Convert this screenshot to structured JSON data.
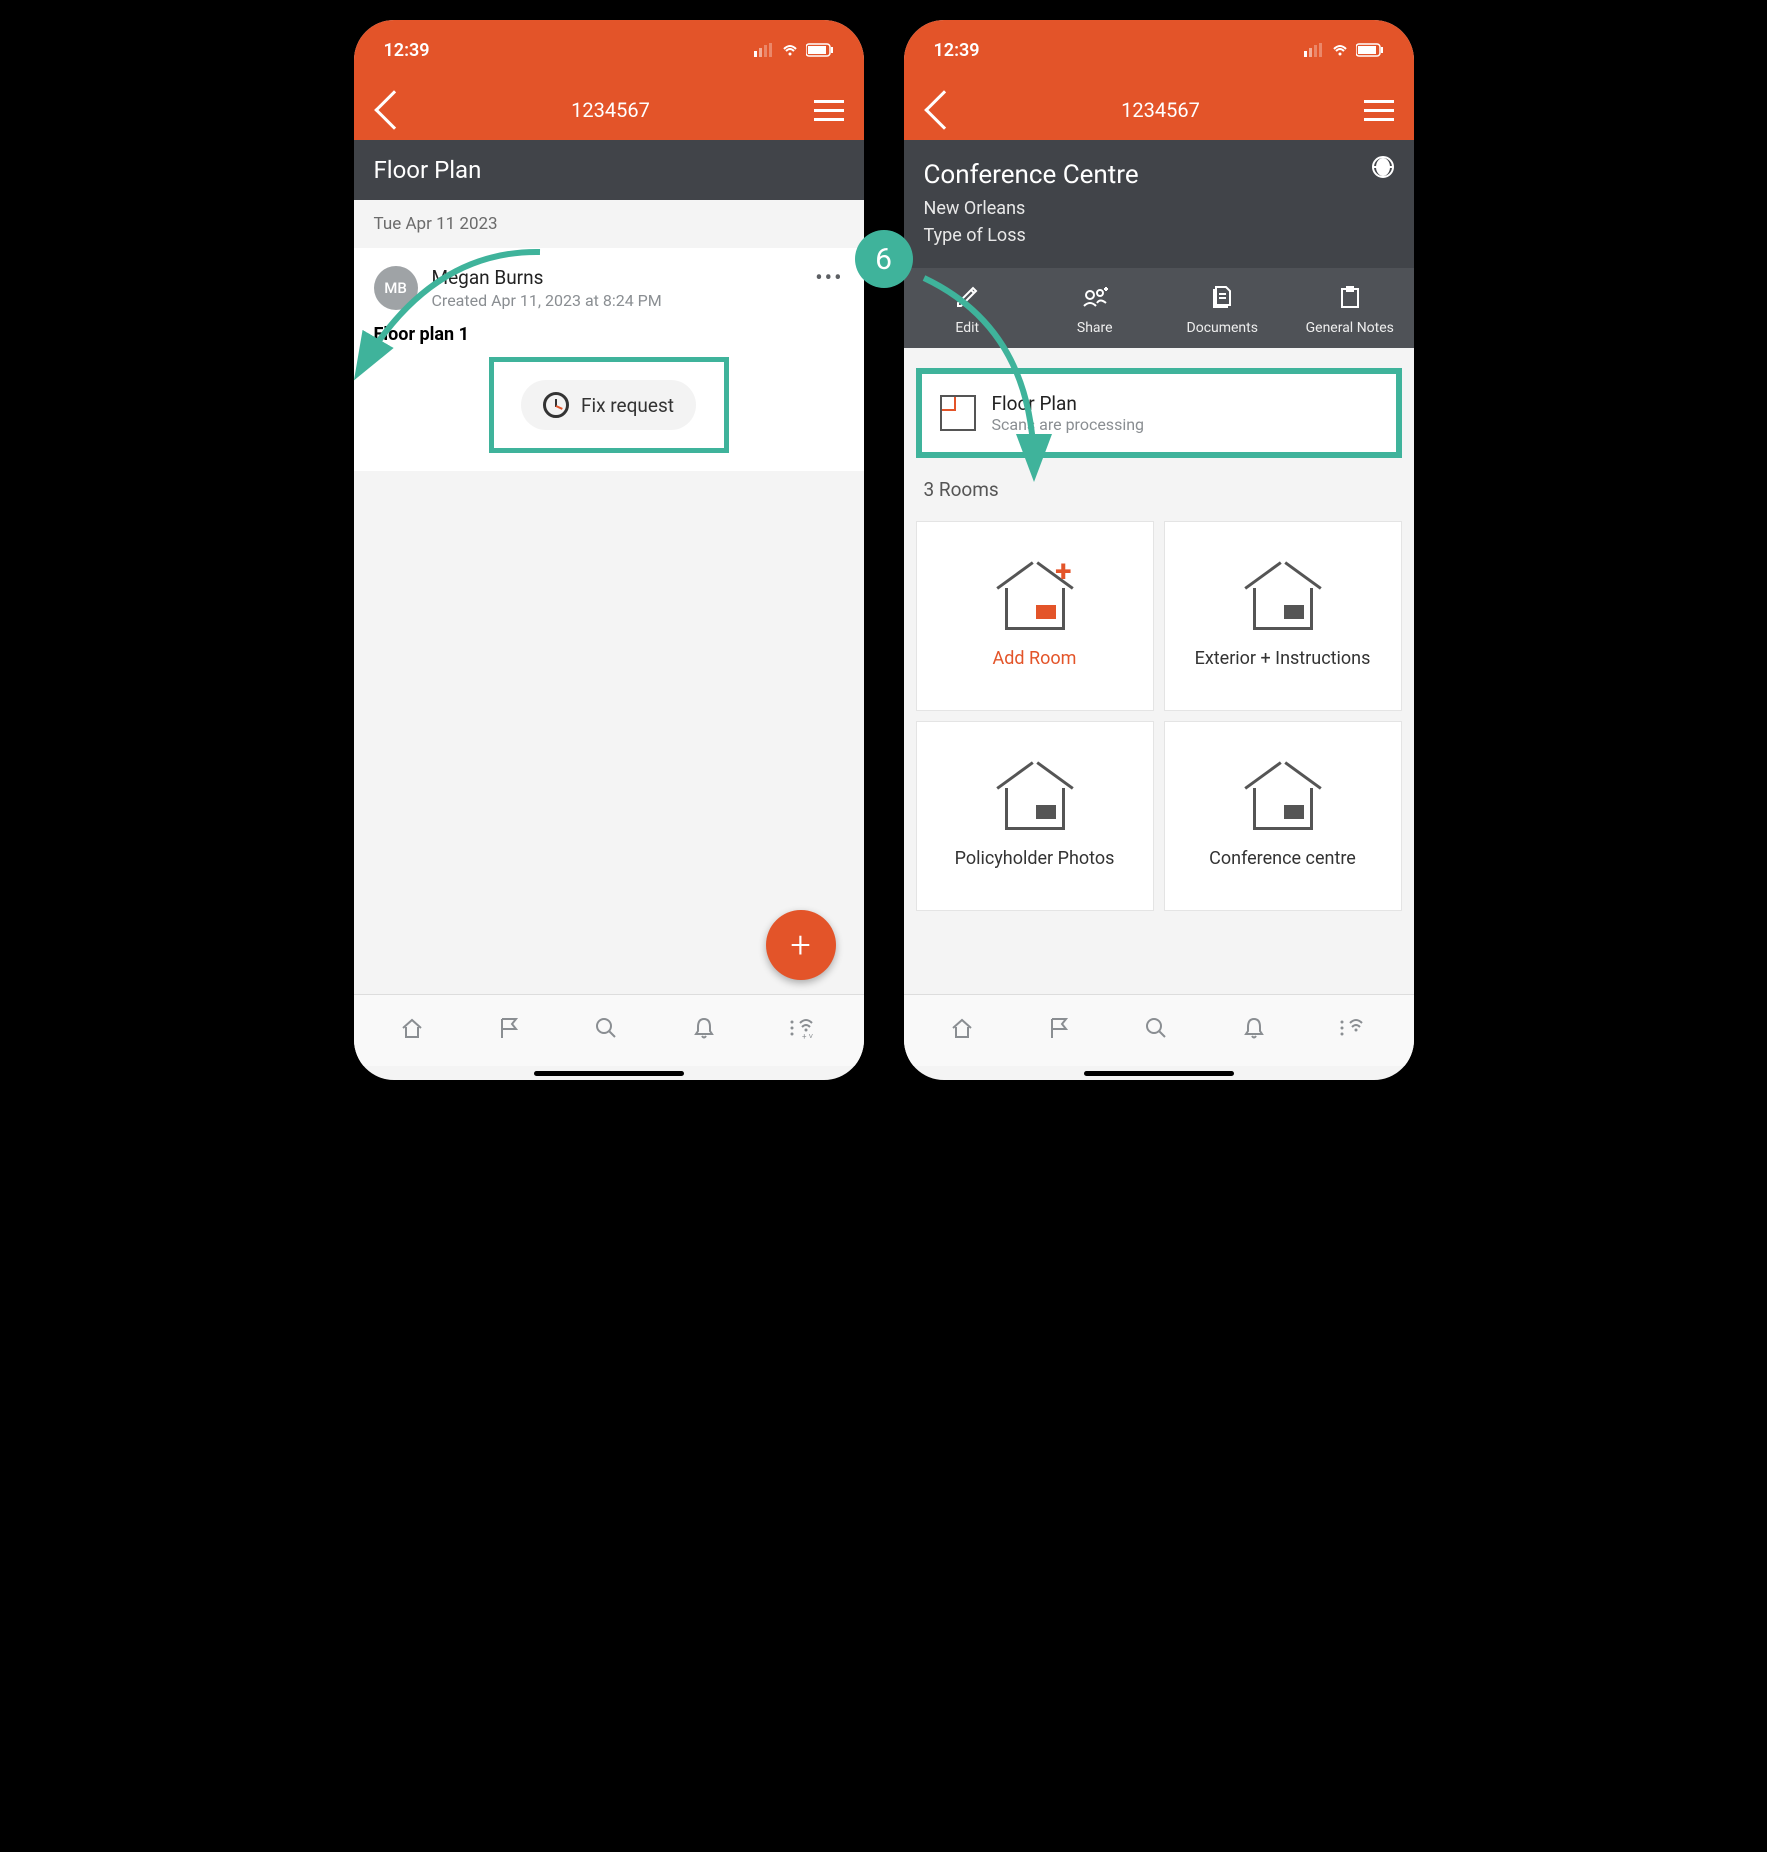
{
  "status": {
    "time": "12:39"
  },
  "header": {
    "title": "1234567"
  },
  "left": {
    "sub_title": "Floor Plan",
    "date": "Tue Apr 11 2023",
    "avatar_initials": "MB",
    "user_name": "Megan Burns",
    "created": "Created Apr 11, 2023 at 8:24 PM",
    "plan_label": "Floor plan 1",
    "fix_request": "Fix request"
  },
  "right": {
    "title": "Conference Centre",
    "city": "New Orleans",
    "loss": "Type of Loss",
    "actions": {
      "edit": "Edit",
      "share": "Share",
      "documents": "Documents",
      "notes": "General Notes"
    },
    "floorplan": {
      "title": "Floor Plan",
      "sub": "Scans are processing"
    },
    "rooms_label": "3 Rooms",
    "rooms": {
      "add": "Add Room",
      "exterior": "Exterior + Instructions",
      "photos": "Policyholder Photos",
      "conf": "Conference centre"
    }
  },
  "step": "6"
}
